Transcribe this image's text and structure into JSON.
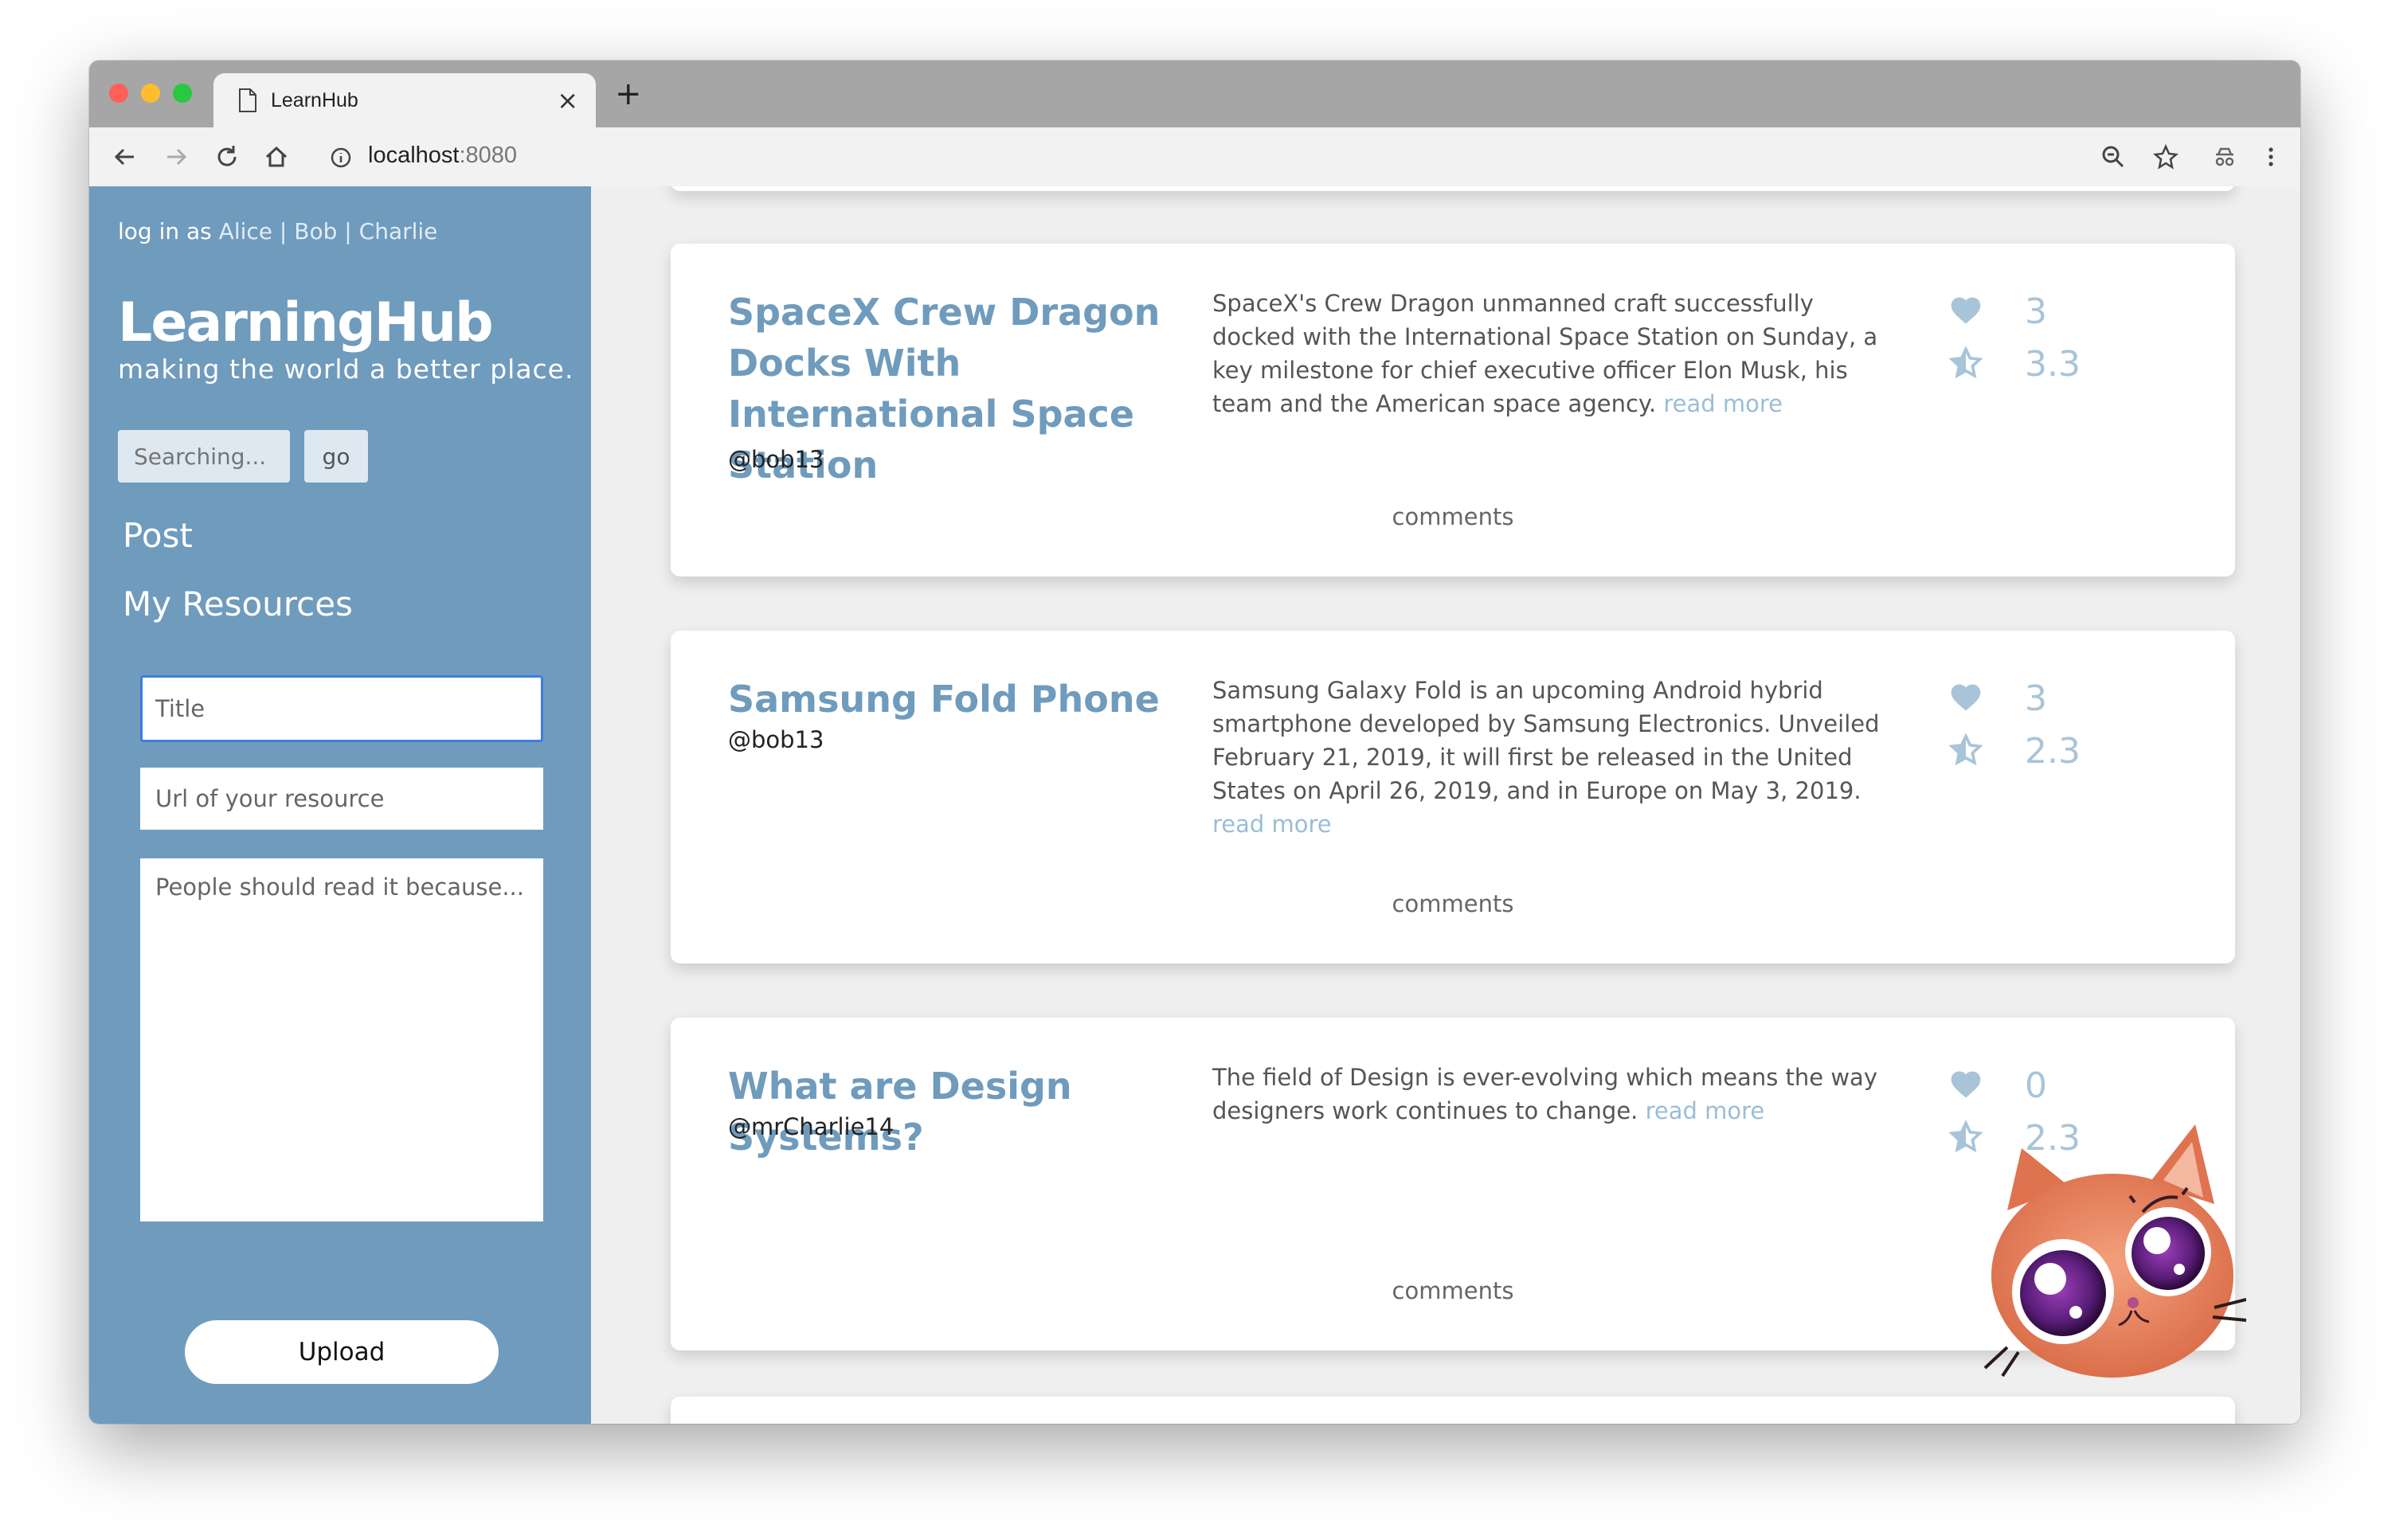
{
  "browser": {
    "tab_title": "LearnHub",
    "tab_close": "×",
    "new_tab": "+",
    "url_host": "localhost",
    "url_port": ":8080"
  },
  "sidebar": {
    "login_prefix": "log in as",
    "users": [
      "Alice",
      "Bob",
      "Charlie"
    ],
    "separator": "|",
    "brand": "LearningHub",
    "tagline": "making the world a better place.",
    "search_placeholder": "Searching...",
    "go_label": "go",
    "nav": {
      "post": "Post",
      "my_resources": "My Resources"
    },
    "form": {
      "title_placeholder": "Title",
      "url_placeholder": "Url of your resource",
      "desc_placeholder": "People should read it because...",
      "upload_label": "Upload"
    }
  },
  "posts": [
    {
      "title": "SpaceX Crew Dragon Docks With International Space Station",
      "author": "@bob13",
      "description": "SpaceX's Crew Dragon unmanned craft successfully docked with the International Space Station on Sunday, a key milestone for chief executive officer Elon Musk, his team and the American space agency.",
      "read_more": "read more",
      "likes": "3",
      "rating": "3.3",
      "comments_label": "comments"
    },
    {
      "title": "Samsung Fold Phone",
      "author": "@bob13",
      "description": "Samsung Galaxy Fold is an upcoming Android hybrid smartphone developed by Samsung Electronics. Unveiled February 21, 2019, it will first be released in the United States on April 26, 2019, and in Europe on May 3, 2019.",
      "read_more": "read more",
      "likes": "3",
      "rating": "2.3",
      "comments_label": "comments"
    },
    {
      "title": "What are Design Systems?",
      "author": "@mrCharlie14",
      "description": "The field of Design is ever-evolving which means the way designers work continues to change.",
      "read_more": "read more",
      "likes": "0",
      "rating": "2.3",
      "comments_label": "comments"
    }
  ],
  "colors": {
    "sidebar": "#6f9bbd",
    "accent": "#6f9bbd",
    "link": "#9bbdd6",
    "stat": "#a8c4d8",
    "focus": "#3d7de0"
  },
  "icons": {
    "like": "heart-icon",
    "rating": "star-icon",
    "mascot": "cat-mascot"
  }
}
